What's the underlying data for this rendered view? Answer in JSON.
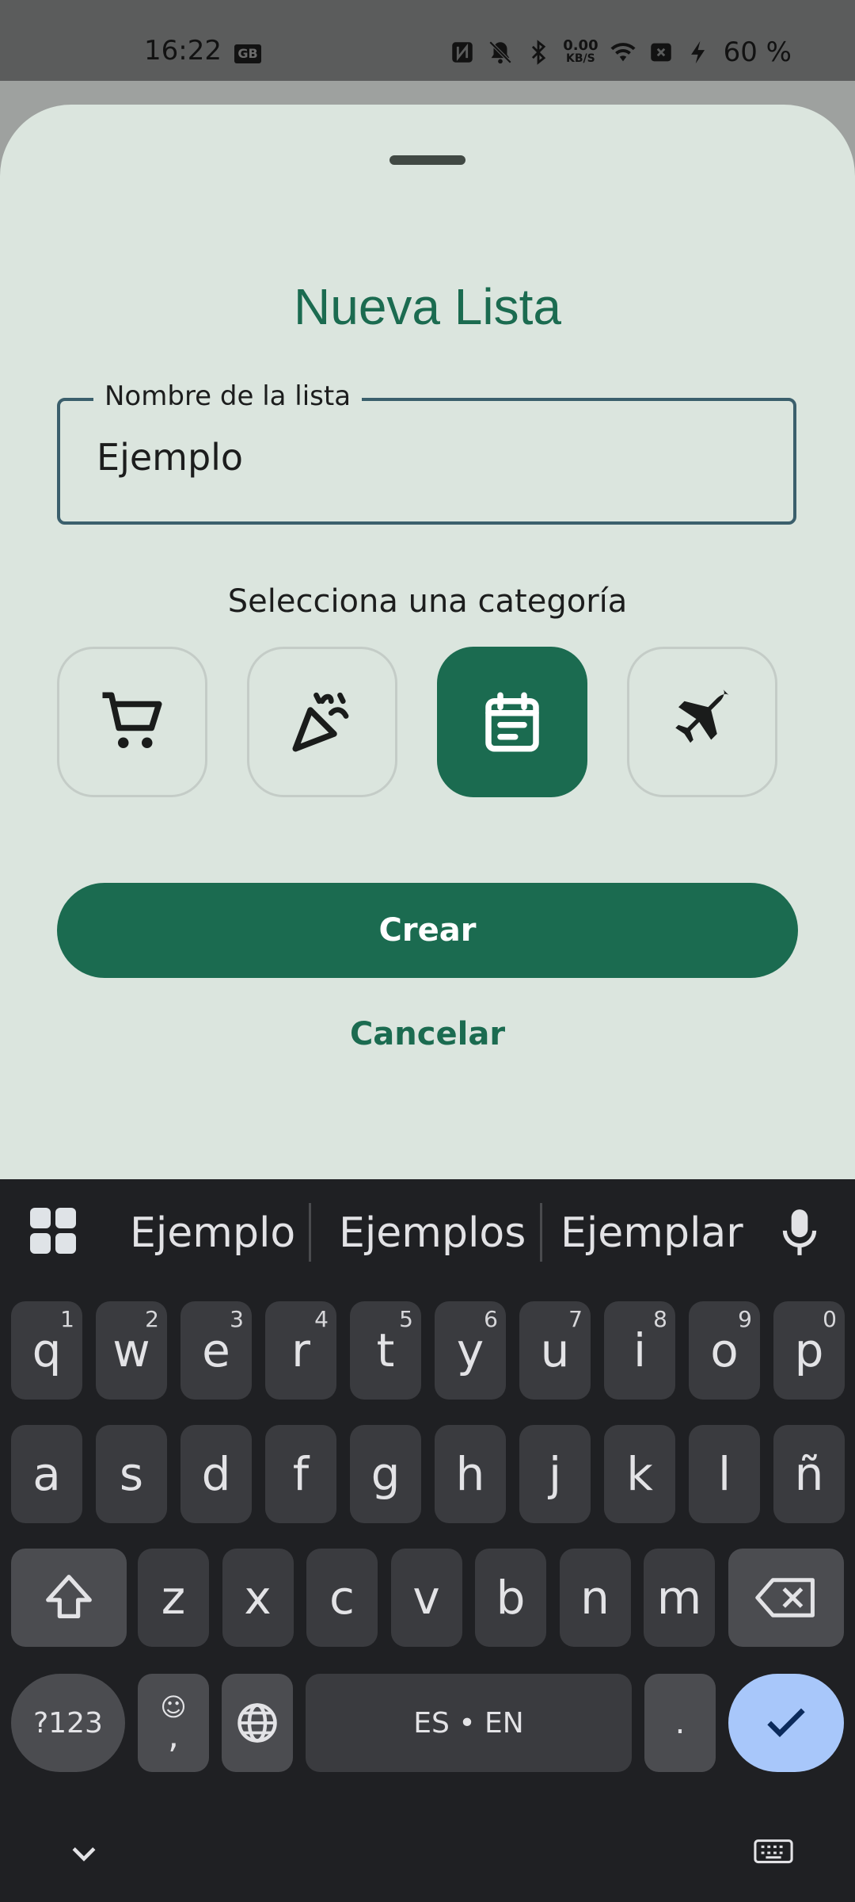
{
  "status_bar": {
    "time": "16:22",
    "left_icon": "GB",
    "net_speed_value": "0.00",
    "net_speed_unit": "KB/S",
    "battery_percent": "60 %",
    "icons": [
      "nfc-icon",
      "bell-off-icon",
      "bluetooth-icon",
      "wifi-icon",
      "sim-off-icon",
      "charging-icon"
    ]
  },
  "sheet": {
    "title": "Nueva Lista",
    "name_field": {
      "label": "Nombre de la lista",
      "value": "Ejemplo"
    },
    "category_label": "Selecciona una categoría",
    "categories": [
      {
        "icon": "shopping-cart-icon",
        "selected": false
      },
      {
        "icon": "party-popper-icon",
        "selected": false
      },
      {
        "icon": "notes-calendar-icon",
        "selected": true
      },
      {
        "icon": "airplane-icon",
        "selected": false
      }
    ],
    "create_label": "Crear",
    "cancel_label": "Cancelar",
    "colors": {
      "accent": "#1b6b50",
      "sheet_bg": "#dbe5de"
    }
  },
  "keyboard": {
    "suggestions": [
      "Ejemplo",
      "Ejemplos",
      "Ejemplar"
    ],
    "row1": [
      {
        "k": "q",
        "n": "1"
      },
      {
        "k": "w",
        "n": "2"
      },
      {
        "k": "e",
        "n": "3"
      },
      {
        "k": "r",
        "n": "4"
      },
      {
        "k": "t",
        "n": "5"
      },
      {
        "k": "y",
        "n": "6"
      },
      {
        "k": "u",
        "n": "7"
      },
      {
        "k": "i",
        "n": "8"
      },
      {
        "k": "o",
        "n": "9"
      },
      {
        "k": "p",
        "n": "0"
      }
    ],
    "row2": [
      "a",
      "s",
      "d",
      "f",
      "g",
      "h",
      "j",
      "k",
      "l",
      "ñ"
    ],
    "row3": [
      "z",
      "x",
      "c",
      "v",
      "b",
      "n",
      "m"
    ],
    "symbols_label": "?123",
    "comma_label": ",",
    "emoji_label": "☺",
    "space_label": "ES • EN",
    "period_label": "."
  }
}
